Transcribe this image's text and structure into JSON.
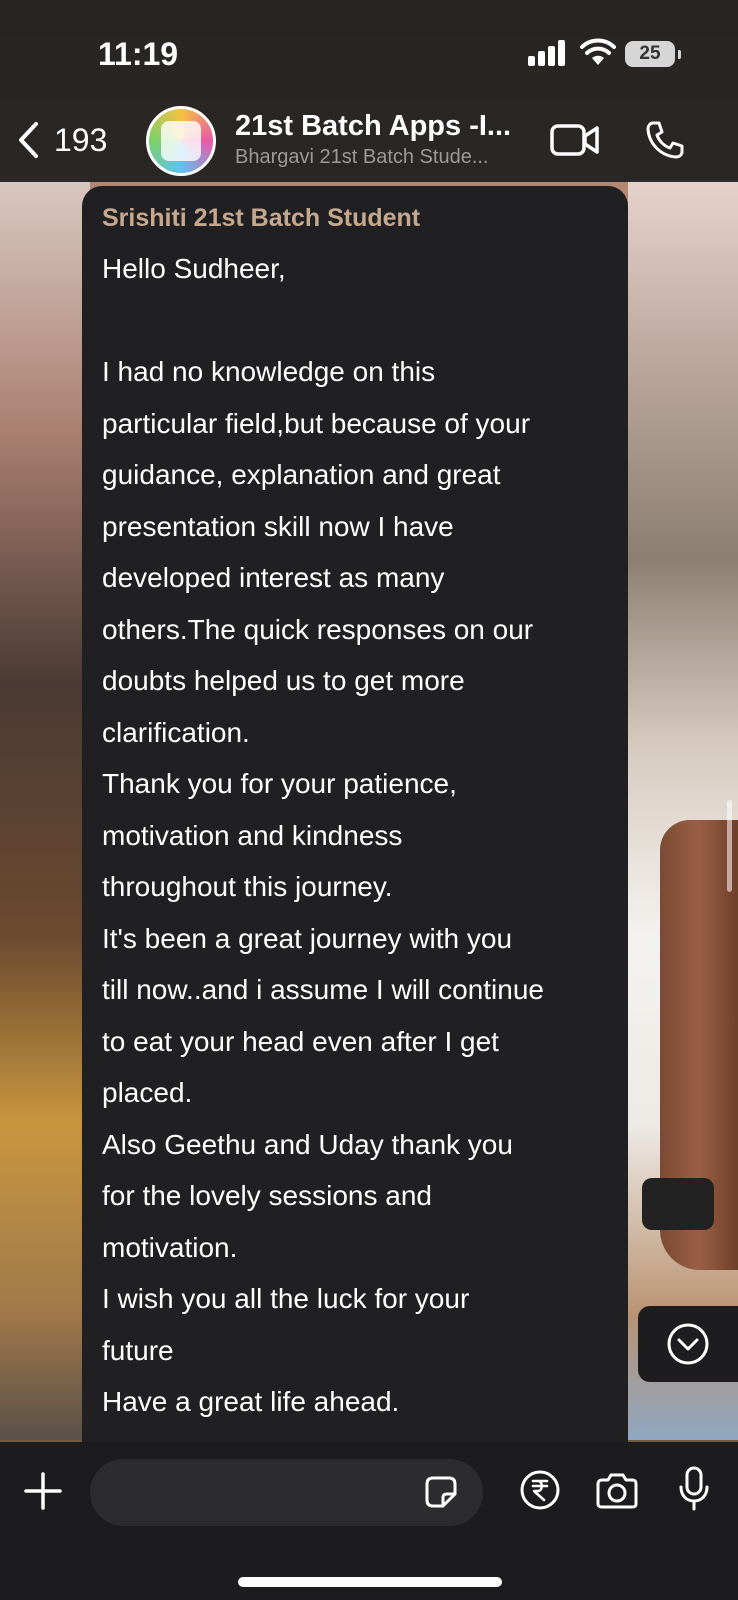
{
  "status_bar": {
    "time": "11:19",
    "battery": "25"
  },
  "header": {
    "back_count": "193",
    "title": "21st Batch Apps -I...",
    "subtitle": "Bhargavi 21st Batch Stude..."
  },
  "message": {
    "sender": "Srishiti 21st Batch Student",
    "lines": [
      "Hello Sudheer,",
      "",
      "I had no knowledge on this",
      "particular field,but because of your",
      "guidance, explanation and great",
      "presentation skill now I have",
      "developed interest as many",
      "others.The quick responses on our",
      "doubts helped us to get more",
      "clarification.",
      "Thank you for your patience,",
      "motivation and kindness",
      "throughout this journey.",
      "It's been a great journey with you",
      "till now..and i assume I will continue",
      "to eat your head even after I get",
      "placed.",
      "Also Geethu and Uday thank you",
      "for the lovely sessions and",
      "motivation.",
      "I wish you all the luck for your",
      "future",
      "Have a great life ahead."
    ]
  },
  "input": {
    "placeholder": ""
  },
  "colors": {
    "sender_name": "#c6a88f",
    "bubble_bg": "#202022",
    "bar_bg": "#1c1c1e"
  }
}
